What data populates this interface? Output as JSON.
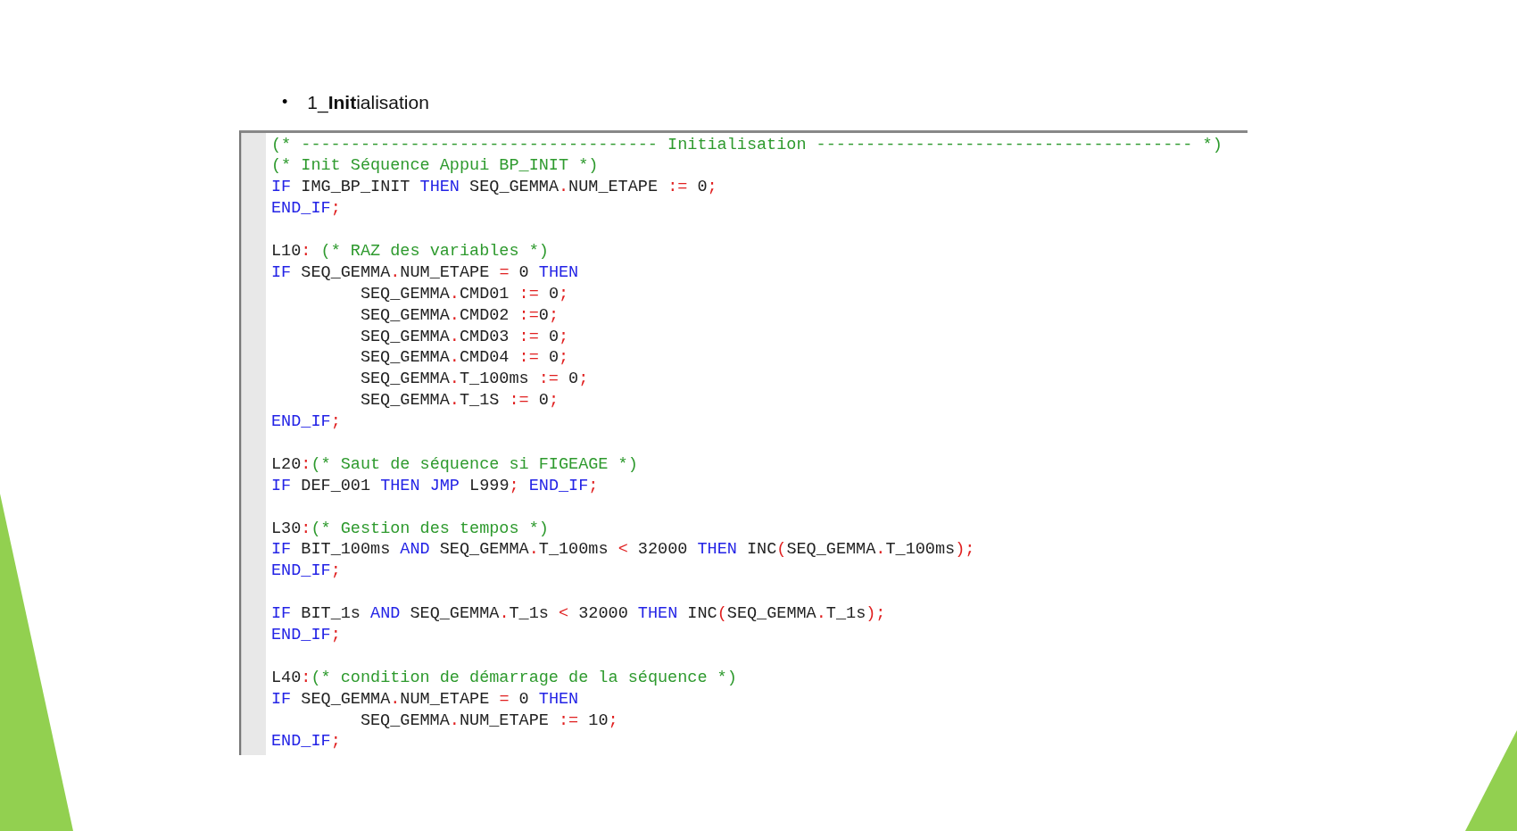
{
  "heading": {
    "bullet": "•",
    "text": "1_**Init**ialisation"
  },
  "code_editor": {
    "lines": [
      {
        "kind": "code",
        "indented": false,
        "tokens": [
          {
            "kind": "comment",
            "text": "(* ------------------------------------ Initialisation -------------------------------------- *)"
          }
        ]
      },
      {
        "kind": "code",
        "indented": false,
        "tokens": [
          {
            "kind": "comment",
            "text": "(* Init Séquence Appui BP_INIT *)"
          }
        ]
      },
      {
        "kind": "code",
        "indented": false,
        "tokens": [
          {
            "kind": "keyword",
            "text": "IF"
          },
          {
            "kind": "text",
            "text": " IMG_BP_INIT "
          },
          {
            "kind": "keyword",
            "text": "THEN"
          },
          {
            "kind": "text",
            "text": " SEQ_GEMMA"
          },
          {
            "kind": "operator",
            "text": "."
          },
          {
            "kind": "text",
            "text": "NUM_ETAPE "
          },
          {
            "kind": "operator",
            "text": ":="
          },
          {
            "kind": "text",
            "text": " 0"
          },
          {
            "kind": "operator",
            "text": ";"
          }
        ]
      },
      {
        "kind": "code",
        "indented": false,
        "tokens": [
          {
            "kind": "keyword",
            "text": "END_IF"
          },
          {
            "kind": "operator",
            "text": ";"
          }
        ]
      },
      {
        "kind": "blank"
      },
      {
        "kind": "code",
        "indented": false,
        "tokens": [
          {
            "kind": "text",
            "text": "L10"
          },
          {
            "kind": "operator",
            "text": ":"
          },
          {
            "kind": "comment",
            "text": " (* RAZ des variables *)"
          }
        ]
      },
      {
        "kind": "code",
        "indented": false,
        "tokens": [
          {
            "kind": "keyword",
            "text": "IF"
          },
          {
            "kind": "text",
            "text": " SEQ_GEMMA"
          },
          {
            "kind": "operator",
            "text": "."
          },
          {
            "kind": "text",
            "text": "NUM_ETAPE "
          },
          {
            "kind": "operator",
            "text": "="
          },
          {
            "kind": "text",
            "text": " 0 "
          },
          {
            "kind": "keyword",
            "text": "THEN"
          }
        ]
      },
      {
        "kind": "code",
        "indented": true,
        "tokens": [
          {
            "kind": "text",
            "text": "SEQ_GEMMA"
          },
          {
            "kind": "operator",
            "text": "."
          },
          {
            "kind": "text",
            "text": "CMD01 "
          },
          {
            "kind": "operator",
            "text": ":="
          },
          {
            "kind": "text",
            "text": " 0"
          },
          {
            "kind": "operator",
            "text": ";"
          }
        ]
      },
      {
        "kind": "code",
        "indented": true,
        "tokens": [
          {
            "kind": "text",
            "text": "SEQ_GEMMA"
          },
          {
            "kind": "operator",
            "text": "."
          },
          {
            "kind": "text",
            "text": "CMD02 "
          },
          {
            "kind": "operator",
            "text": ":="
          },
          {
            "kind": "text",
            "text": "0"
          },
          {
            "kind": "operator",
            "text": ";"
          }
        ]
      },
      {
        "kind": "code",
        "indented": true,
        "tokens": [
          {
            "kind": "text",
            "text": "SEQ_GEMMA"
          },
          {
            "kind": "operator",
            "text": "."
          },
          {
            "kind": "text",
            "text": "CMD03 "
          },
          {
            "kind": "operator",
            "text": ":="
          },
          {
            "kind": "text",
            "text": " 0"
          },
          {
            "kind": "operator",
            "text": ";"
          }
        ]
      },
      {
        "kind": "code",
        "indented": true,
        "tokens": [
          {
            "kind": "text",
            "text": "SEQ_GEMMA"
          },
          {
            "kind": "operator",
            "text": "."
          },
          {
            "kind": "text",
            "text": "CMD04 "
          },
          {
            "kind": "operator",
            "text": ":="
          },
          {
            "kind": "text",
            "text": " 0"
          },
          {
            "kind": "operator",
            "text": ";"
          }
        ]
      },
      {
        "kind": "code",
        "indented": true,
        "tokens": [
          {
            "kind": "text",
            "text": "SEQ_GEMMA"
          },
          {
            "kind": "operator",
            "text": "."
          },
          {
            "kind": "text",
            "text": "T_100ms "
          },
          {
            "kind": "operator",
            "text": ":="
          },
          {
            "kind": "text",
            "text": " 0"
          },
          {
            "kind": "operator",
            "text": ";"
          }
        ]
      },
      {
        "kind": "code",
        "indented": true,
        "tokens": [
          {
            "kind": "text",
            "text": "SEQ_GEMMA"
          },
          {
            "kind": "operator",
            "text": "."
          },
          {
            "kind": "text",
            "text": "T_1S "
          },
          {
            "kind": "operator",
            "text": ":="
          },
          {
            "kind": "text",
            "text": " 0"
          },
          {
            "kind": "operator",
            "text": ";"
          }
        ]
      },
      {
        "kind": "code",
        "indented": false,
        "tokens": [
          {
            "kind": "keyword",
            "text": "END_IF"
          },
          {
            "kind": "operator",
            "text": ";"
          }
        ]
      },
      {
        "kind": "blank"
      },
      {
        "kind": "code",
        "indented": false,
        "tokens": [
          {
            "kind": "text",
            "text": "L20"
          },
          {
            "kind": "operator",
            "text": ":"
          },
          {
            "kind": "comment",
            "text": "(* Saut de séquence si FIGEAGE *)"
          }
        ]
      },
      {
        "kind": "code",
        "indented": false,
        "tokens": [
          {
            "kind": "keyword",
            "text": "IF"
          },
          {
            "kind": "text",
            "text": " DEF_001 "
          },
          {
            "kind": "keyword",
            "text": "THEN JMP"
          },
          {
            "kind": "text",
            "text": " L999"
          },
          {
            "kind": "operator",
            "text": ";"
          },
          {
            "kind": "keyword",
            "text": " END_IF"
          },
          {
            "kind": "operator",
            "text": ";"
          }
        ]
      },
      {
        "kind": "blank"
      },
      {
        "kind": "code",
        "indented": false,
        "tokens": [
          {
            "kind": "text",
            "text": "L30"
          },
          {
            "kind": "operator",
            "text": ":"
          },
          {
            "kind": "comment",
            "text": "(* Gestion des tempos *)"
          }
        ]
      },
      {
        "kind": "code",
        "indented": false,
        "tokens": [
          {
            "kind": "keyword",
            "text": "IF"
          },
          {
            "kind": "text",
            "text": " BIT_100ms "
          },
          {
            "kind": "keyword",
            "text": "AND"
          },
          {
            "kind": "text",
            "text": " SEQ_GEMMA"
          },
          {
            "kind": "operator",
            "text": "."
          },
          {
            "kind": "text",
            "text": "T_100ms "
          },
          {
            "kind": "operator",
            "text": "<"
          },
          {
            "kind": "text",
            "text": " 32000 "
          },
          {
            "kind": "keyword",
            "text": "THEN"
          },
          {
            "kind": "text",
            "text": " INC"
          },
          {
            "kind": "operator",
            "text": "("
          },
          {
            "kind": "text",
            "text": "SEQ_GEMMA"
          },
          {
            "kind": "operator",
            "text": "."
          },
          {
            "kind": "text",
            "text": "T_100ms"
          },
          {
            "kind": "operator",
            "text": ");"
          }
        ]
      },
      {
        "kind": "code",
        "indented": false,
        "tokens": [
          {
            "kind": "keyword",
            "text": "END_IF"
          },
          {
            "kind": "operator",
            "text": ";"
          }
        ]
      },
      {
        "kind": "blank"
      },
      {
        "kind": "code",
        "indented": false,
        "tokens": [
          {
            "kind": "keyword",
            "text": "IF"
          },
          {
            "kind": "text",
            "text": " BIT_1s "
          },
          {
            "kind": "keyword",
            "text": "AND"
          },
          {
            "kind": "text",
            "text": " SEQ_GEMMA"
          },
          {
            "kind": "operator",
            "text": "."
          },
          {
            "kind": "text",
            "text": "T_1s "
          },
          {
            "kind": "operator",
            "text": "<"
          },
          {
            "kind": "text",
            "text": " 32000 "
          },
          {
            "kind": "keyword",
            "text": "THEN"
          },
          {
            "kind": "text",
            "text": " INC"
          },
          {
            "kind": "operator",
            "text": "("
          },
          {
            "kind": "text",
            "text": "SEQ_GEMMA"
          },
          {
            "kind": "operator",
            "text": "."
          },
          {
            "kind": "text",
            "text": "T_1s"
          },
          {
            "kind": "operator",
            "text": ");"
          }
        ]
      },
      {
        "kind": "code",
        "indented": false,
        "tokens": [
          {
            "kind": "keyword",
            "text": "END_IF"
          },
          {
            "kind": "operator",
            "text": ";"
          }
        ]
      },
      {
        "kind": "blank"
      },
      {
        "kind": "code",
        "indented": false,
        "tokens": [
          {
            "kind": "text",
            "text": "L40"
          },
          {
            "kind": "operator",
            "text": ":"
          },
          {
            "kind": "comment",
            "text": "(* condition de démarrage de la séquence *)"
          }
        ]
      },
      {
        "kind": "code",
        "indented": false,
        "tokens": [
          {
            "kind": "keyword",
            "text": "IF"
          },
          {
            "kind": "text",
            "text": " SEQ_GEMMA"
          },
          {
            "kind": "operator",
            "text": "."
          },
          {
            "kind": "text",
            "text": "NUM_ETAPE "
          },
          {
            "kind": "operator",
            "text": "="
          },
          {
            "kind": "text",
            "text": " 0 "
          },
          {
            "kind": "keyword",
            "text": "THEN"
          }
        ]
      },
      {
        "kind": "code",
        "indented": true,
        "tokens": [
          {
            "kind": "text",
            "text": "SEQ_GEMMA"
          },
          {
            "kind": "operator",
            "text": "."
          },
          {
            "kind": "text",
            "text": "NUM_ETAPE "
          },
          {
            "kind": "operator",
            "text": ":="
          },
          {
            "kind": "text",
            "text": " 10"
          },
          {
            "kind": "operator",
            "text": ";"
          }
        ]
      },
      {
        "kind": "code",
        "indented": false,
        "tokens": [
          {
            "kind": "keyword",
            "text": "END_IF"
          },
          {
            "kind": "operator",
            "text": ";"
          }
        ]
      }
    ]
  }
}
